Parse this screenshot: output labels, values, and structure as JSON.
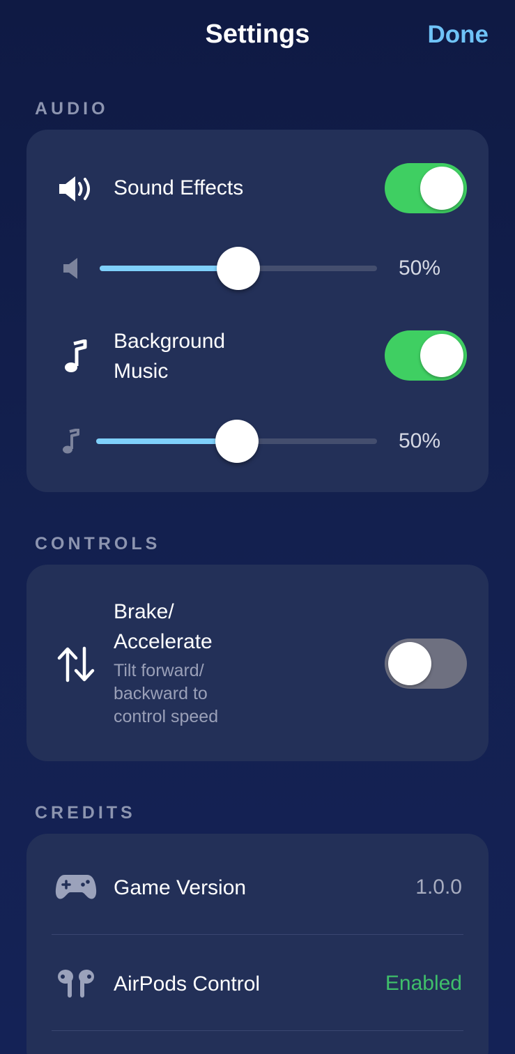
{
  "nav": {
    "title": "Settings",
    "done_label": "Done"
  },
  "audio": {
    "header": "AUDIO",
    "sound_effects": {
      "label": "Sound Effects",
      "enabled": true,
      "volume": 50,
      "volume_text": "50%"
    },
    "background_music": {
      "label_line1": "Background",
      "label_line2": "Music",
      "enabled": true,
      "volume": 50,
      "volume_text": "50%"
    }
  },
  "controls": {
    "header": "CONTROLS",
    "brake_accelerate": {
      "label_line1": "Brake/",
      "label_line2": "Accelerate",
      "desc_line1": "Tilt forward/",
      "desc_line2": "backward to",
      "desc_line3": "control speed",
      "enabled": false
    }
  },
  "credits": {
    "header": "CREDITS",
    "game_version": {
      "label": "Game Version",
      "value": "1.0.0"
    },
    "airpods_control": {
      "label": "AirPods Control",
      "value": "Enabled"
    }
  },
  "colors": {
    "accent": "#6fc3f7",
    "toggle_on": "#3fcf62",
    "toggle_off": "#6e7080",
    "enabled_text": "#3fbf6a",
    "card": "#233058",
    "background": "#13204f"
  },
  "icons": {
    "sound_effects": "speaker-wave-icon",
    "sfx_slider": "speaker-small-icon",
    "background_music": "music-note-icon",
    "music_slider": "music-note-small-icon",
    "brake_accelerate": "arrows-up-down-icon",
    "game_version": "gamecontroller-icon",
    "airpods_control": "airpods-icon"
  }
}
